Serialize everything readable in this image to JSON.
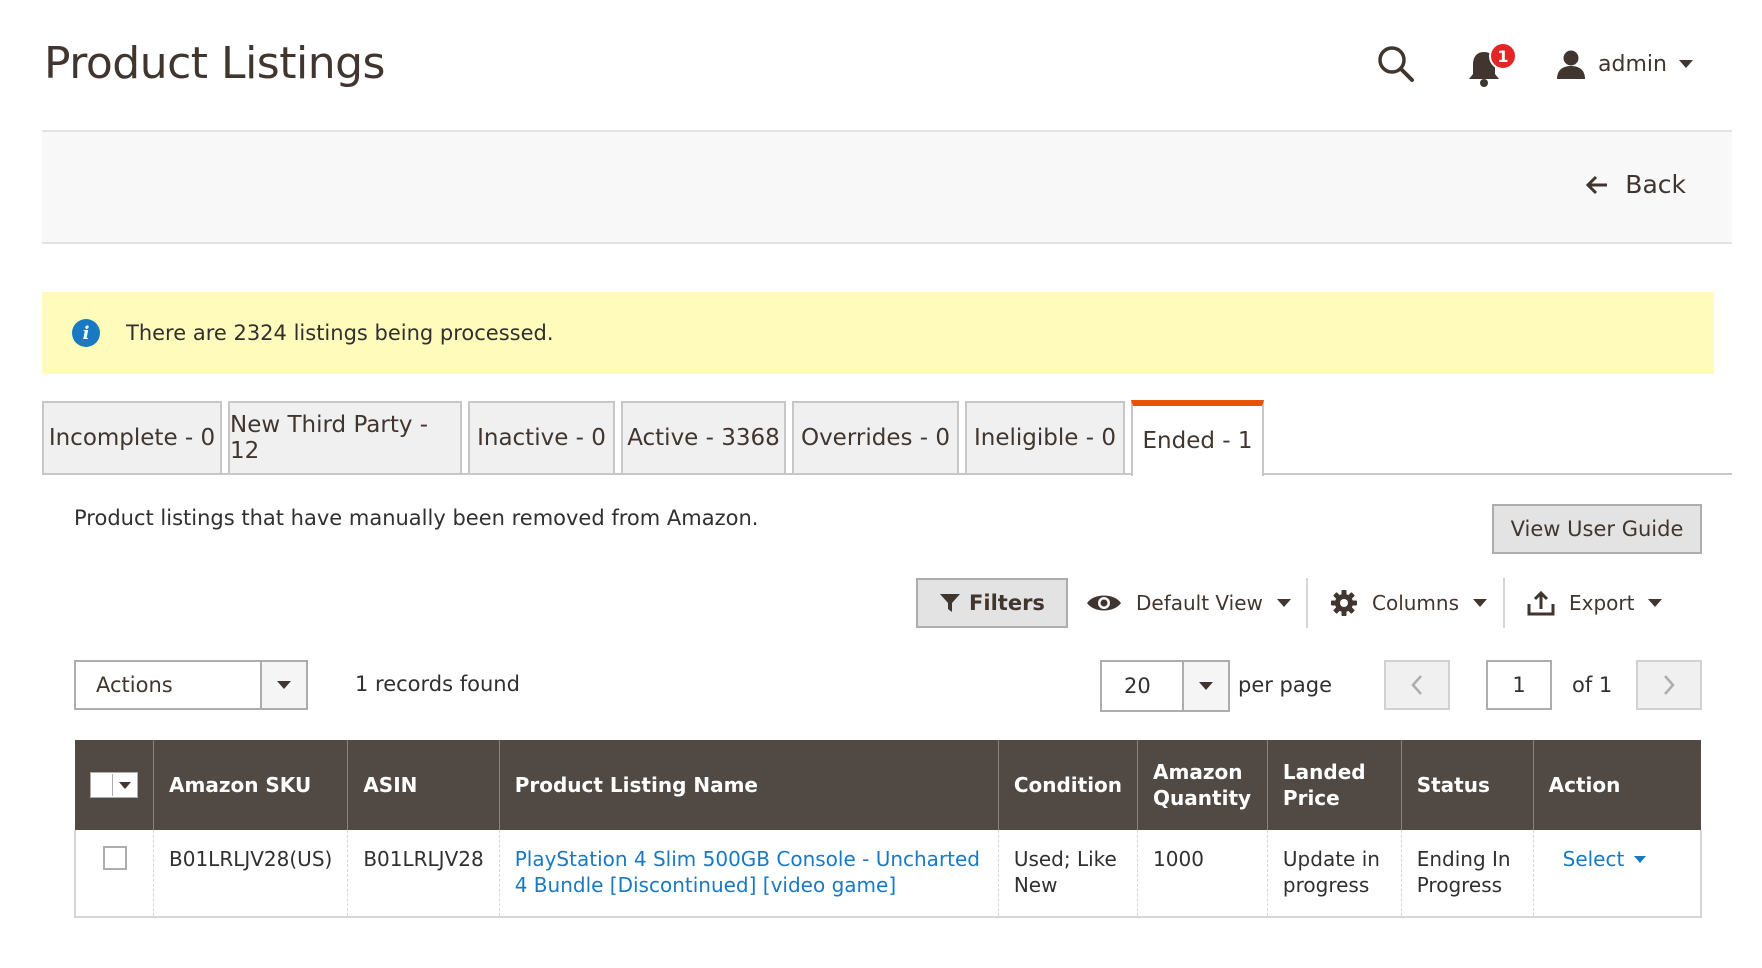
{
  "header": {
    "title": "Product Listings",
    "notifications_count": "1",
    "user_name": "admin"
  },
  "page_actions": {
    "back_label": "Back"
  },
  "info_message": "There are 2324 listings being processed.",
  "tabs": [
    {
      "label": "Incomplete - 0",
      "active": false
    },
    {
      "label": "New Third Party - 12",
      "active": false
    },
    {
      "label": "Inactive - 0",
      "active": false
    },
    {
      "label": "Active - 3368",
      "active": false
    },
    {
      "label": "Overrides - 0",
      "active": false
    },
    {
      "label": "Ineligible - 0",
      "active": false
    },
    {
      "label": "Ended - 1",
      "active": true
    }
  ],
  "tab_description": "Product listings that have manually been removed from Amazon.",
  "view_guide_label": "View User Guide",
  "grid_controls": {
    "filters_label": "Filters",
    "view_label": "Default View",
    "columns_label": "Columns",
    "export_label": "Export"
  },
  "mass_actions": {
    "actions_label": "Actions",
    "records_found": "1 records found"
  },
  "pager": {
    "per_page_value": "20",
    "per_page_label": "per page",
    "current_page": "1",
    "of_label": "of 1"
  },
  "table": {
    "headers": {
      "sku": "Amazon SKU",
      "asin": "ASIN",
      "name": "Product Listing Name",
      "condition": "Condition",
      "quantity": "Amazon Quantity",
      "price": "Landed Price",
      "status": "Status",
      "action": "Action"
    },
    "rows": [
      {
        "sku": "B01LRLJV28(US)",
        "asin": "B01LRLJV28",
        "name": "PlayStation 4 Slim 500GB Console - Uncharted 4 Bundle [Discontinued] [video game]",
        "condition": "Used; Like New",
        "quantity": "1000",
        "price": "Update in progress",
        "status": "Ending In Progress",
        "action": "Select"
      }
    ]
  },
  "colors": {
    "accent_tab": "#eb5202",
    "header_bg": "#514943",
    "link": "#1979c3",
    "notice_bg": "#fffbbb",
    "badge": "#e22626"
  }
}
